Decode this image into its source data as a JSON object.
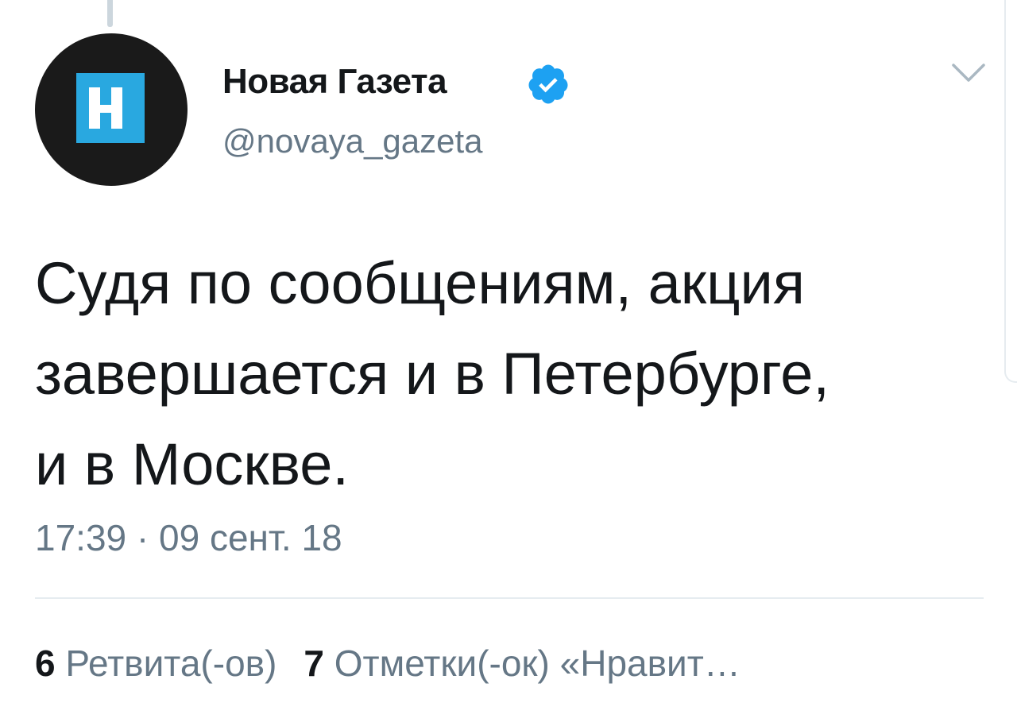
{
  "tweet": {
    "author": {
      "display_name": "Новая Газета",
      "handle": "@novaya_gazeta",
      "verified": true,
      "avatar_icon": "novaya-gazeta-logo-icon"
    },
    "text_lines": [
      "Судя по сообщениям, акция",
      "завершается и в Петербурге,",
      "и в Москве."
    ],
    "timestamp": "17:39 · 09 сент. 18",
    "stats": {
      "retweets": {
        "count": "6",
        "label": "Ретвита(-ов)"
      },
      "likes": {
        "count": "7",
        "label": "Отметки(-ок) «Нравит…"
      }
    }
  },
  "icons": {
    "verified": "verified-badge-icon",
    "more": "chevron-down-icon"
  },
  "colors": {
    "verified_blue": "#1da1f2",
    "secondary_text": "#657786",
    "primary_text": "#14171a",
    "logo_blue": "#29a8e0",
    "avatar_bg": "#1a1a1a",
    "divider": "#e6ecf0"
  }
}
